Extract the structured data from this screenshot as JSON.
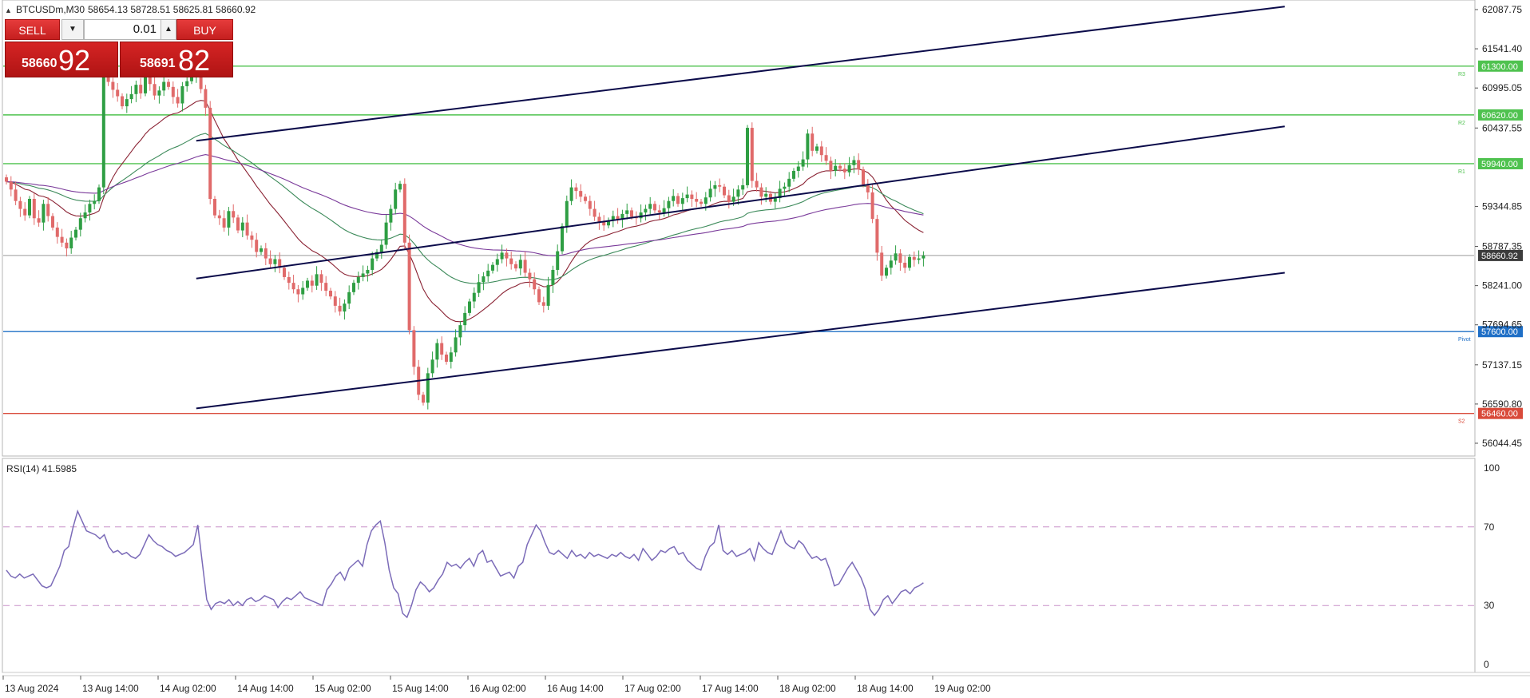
{
  "header": {
    "symbol": "BTCUSDm,M30",
    "ohlc": "58654.13 58728.51 58625.81 58660.92"
  },
  "trade_panel": {
    "sell_label": "SELL",
    "buy_label": "BUY",
    "lot_value": "0.01",
    "sell_price_small": "58660",
    "sell_price_big": "92",
    "buy_price_small": "58691",
    "buy_price_big": "82"
  },
  "price_axis": {
    "ticks": [
      "62087.75",
      "61541.40",
      "60995.05",
      "60437.55",
      "59344.85",
      "58787.35",
      "58241.00",
      "57694.65",
      "57137.15",
      "56590.80",
      "56044.45"
    ],
    "tick_values": [
      62087.75,
      61541.4,
      60995.05,
      60437.55,
      59344.85,
      58787.35,
      58241.0,
      57694.65,
      57137.15,
      56590.8,
      56044.45
    ]
  },
  "levels": [
    {
      "name": "R3",
      "price": 61300.0,
      "label": "61300.00",
      "color": "#4fc24f",
      "tag": "R3"
    },
    {
      "name": "R2",
      "price": 60620.0,
      "label": "60620.00",
      "color": "#4fc24f",
      "tag": "R2"
    },
    {
      "name": "R1",
      "price": 59940.0,
      "label": "59940.00",
      "color": "#4fc24f",
      "tag": "R1"
    },
    {
      "name": "Pivot",
      "price": 57600.0,
      "label": "57600.00",
      "color": "#1f6fc6",
      "tag": "Pivot"
    },
    {
      "name": "S2",
      "price": 56460.0,
      "label": "56460.00",
      "color": "#d94a3a",
      "tag": "S2"
    }
  ],
  "current_price": {
    "price": 58660.92,
    "label": "58660.92",
    "color": "#3c3c3c"
  },
  "time_axis": [
    "13 Aug 2024",
    "13 Aug 14:00",
    "14 Aug 02:00",
    "14 Aug 14:00",
    "15 Aug 02:00",
    "15 Aug 14:00",
    "16 Aug 02:00",
    "16 Aug 14:00",
    "17 Aug 02:00",
    "17 Aug 14:00",
    "18 Aug 02:00",
    "18 Aug 14:00",
    "19 Aug 02:00"
  ],
  "rsi": {
    "label": "RSI(14) 41.5985",
    "ticks": [
      "100",
      "70",
      "30",
      "0"
    ],
    "tick_values": [
      100,
      70,
      30,
      0
    ],
    "levels": [
      70,
      30
    ],
    "color": "#7b6bb8",
    "values": [
      48,
      45,
      44,
      46,
      44,
      45,
      46,
      43,
      40,
      39,
      40,
      45,
      50,
      58,
      60,
      70,
      78,
      73,
      68,
      67,
      66,
      64,
      66,
      60,
      57,
      58,
      56,
      57,
      55,
      54,
      56,
      61,
      66,
      63,
      61,
      60,
      58,
      57,
      55,
      56,
      57,
      59,
      61,
      71,
      52,
      33,
      28,
      31,
      32,
      31,
      33,
      30,
      32,
      30,
      33,
      34,
      32,
      33,
      35,
      34,
      33,
      29,
      32,
      34,
      33,
      35,
      37,
      34,
      33,
      32,
      31,
      30,
      38,
      41,
      45,
      47,
      43,
      49,
      51,
      53,
      50,
      61,
      68,
      71,
      73,
      62,
      48,
      39,
      36,
      26,
      24,
      30,
      38,
      42,
      40,
      37,
      39,
      43,
      46,
      52,
      50,
      51,
      49,
      52,
      54,
      50,
      56,
      58,
      52,
      53,
      49,
      45,
      46,
      47,
      44,
      50,
      52,
      61,
      66,
      71,
      68,
      62,
      57,
      56,
      58,
      56,
      54,
      58,
      55,
      56,
      54,
      57,
      55,
      56,
      55,
      54,
      56,
      55,
      57,
      55,
      54,
      56,
      53,
      59,
      56,
      53,
      55,
      58,
      57,
      59,
      60,
      56,
      57,
      53,
      51,
      49,
      48,
      55,
      60,
      62,
      71,
      58,
      56,
      58,
      55,
      56,
      57,
      59,
      53,
      62,
      59,
      57,
      56,
      62,
      68,
      62,
      60,
      59,
      63,
      61,
      57,
      54,
      55,
      53,
      54,
      48,
      40,
      41,
      45,
      49,
      52,
      48,
      44,
      38,
      28,
      25,
      28,
      33,
      35,
      31,
      34,
      37,
      38,
      36,
      39,
      40,
      41.6
    ]
  },
  "main_chart": {
    "price_min": 55900,
    "price_max": 62250,
    "candle_up_color": "#2e9e43",
    "candle_down_color": "#e06a6a",
    "closes": [
      59690,
      59580,
      59420,
      59310,
      59220,
      59450,
      59180,
      59120,
      59380,
      59210,
      59050,
      58920,
      58840,
      58760,
      58910,
      59020,
      59180,
      59260,
      59380,
      59420,
      59610,
      61220,
      61080,
      60970,
      60880,
      60740,
      60840,
      60910,
      61040,
      60920,
      61180,
      61050,
      60890,
      60960,
      61080,
      61010,
      60870,
      60780,
      61020,
      61090,
      61160,
      61200,
      60980,
      60720,
      59450,
      59220,
      59180,
      59050,
      59280,
      59190,
      59010,
      59120,
      58940,
      58880,
      58710,
      58760,
      58620,
      58540,
      58610,
      58490,
      58360,
      58280,
      58190,
      58120,
      58210,
      58310,
      58240,
      58400,
      58280,
      58170,
      58090,
      57960,
      57880,
      57990,
      58150,
      58280,
      58360,
      58410,
      58460,
      58620,
      58710,
      58810,
      59120,
      59310,
      59580,
      59660,
      58840,
      57620,
      57110,
      56720,
      56610,
      57020,
      57210,
      57440,
      57280,
      57180,
      57310,
      57520,
      57690,
      57860,
      58020,
      58140,
      58290,
      58370,
      58450,
      58530,
      58610,
      58700,
      58620,
      58540,
      58480,
      58600,
      58420,
      58330,
      58190,
      58010,
      57960,
      58250,
      58460,
      58720,
      59070,
      59420,
      59610,
      59560,
      59480,
      59420,
      59310,
      59200,
      59130,
      59080,
      59150,
      59210,
      59160,
      59240,
      59290,
      59200,
      59180,
      59260,
      59310,
      59380,
      59290,
      59260,
      59320,
      59420,
      59490,
      59380,
      59460,
      59510,
      59450,
      59410,
      59380,
      59470,
      59590,
      59640,
      59620,
      59500,
      59410,
      59480,
      59580,
      59640,
      60440,
      59700,
      59610,
      59480,
      59520,
      59410,
      59460,
      59590,
      59620,
      59730,
      59840,
      59900,
      60000,
      60360,
      60120,
      60180,
      60060,
      59980,
      59840,
      59910,
      59870,
      59820,
      59920,
      59990,
      59860,
      59650,
      59540,
      59170,
      58700,
      58380,
      58490,
      58590,
      58690,
      58560,
      58490,
      58640,
      58600,
      58620,
      58661
    ],
    "channel_lines": [
      {
        "from_bar": 41,
        "from_price": 60260,
        "to_bar": 276,
        "to_price": 62130
      },
      {
        "from_bar": 41,
        "from_price": 58340,
        "to_bar": 276,
        "to_price": 60460
      },
      {
        "from_bar": 41,
        "from_price": 56530,
        "to_bar": 276,
        "to_price": 58420
      }
    ],
    "ma_lines": [
      {
        "color": "#8a2233",
        "period": 20
      },
      {
        "color": "#3c8a5a",
        "period": 50
      },
      {
        "color": "#7a3a9a",
        "period": 100
      }
    ]
  }
}
